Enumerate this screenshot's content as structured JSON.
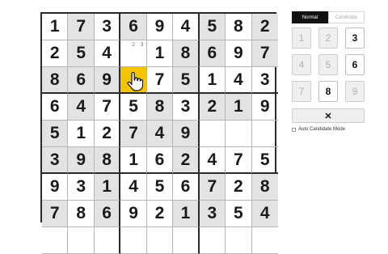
{
  "board": {
    "rows": [
      [
        "1",
        "7",
        "3",
        "6",
        "9",
        "4",
        "5",
        "8",
        "2"
      ],
      [
        "2",
        "5",
        "4",
        "",
        "1",
        "8",
        "6",
        "9",
        "7"
      ],
      [
        "8",
        "6",
        "9",
        "",
        "7",
        "5",
        "1",
        "4",
        "3"
      ],
      [
        "6",
        "4",
        "7",
        "5",
        "8",
        "3",
        "2",
        "1",
        "9"
      ],
      [
        "5",
        "1",
        "2",
        "7",
        "4",
        "9",
        "",
        "",
        ""
      ],
      [
        "3",
        "9",
        "8",
        "1",
        "6",
        "2",
        "4",
        "7",
        "5"
      ],
      [
        "9",
        "3",
        "1",
        "4",
        "5",
        "6",
        "7",
        "2",
        "8"
      ],
      [
        "7",
        "8",
        "6",
        "9",
        "2",
        "1",
        "3",
        "5",
        "4"
      ],
      [
        "",
        "",
        "",
        "",
        "",
        "",
        "",
        "",
        ""
      ]
    ],
    "shaded": [
      [
        0,
        1
      ],
      [
        0,
        3
      ],
      [
        0,
        6
      ],
      [
        0,
        8
      ],
      [
        1,
        1
      ],
      [
        1,
        5
      ],
      [
        1,
        6
      ],
      [
        1,
        8
      ],
      [
        2,
        0
      ],
      [
        2,
        1
      ],
      [
        2,
        2
      ],
      [
        2,
        5
      ],
      [
        3,
        1
      ],
      [
        3,
        4
      ],
      [
        3,
        6
      ],
      [
        3,
        7
      ],
      [
        4,
        0
      ],
      [
        4,
        3
      ],
      [
        4,
        4
      ],
      [
        4,
        5
      ],
      [
        5,
        0
      ],
      [
        5,
        1
      ],
      [
        5,
        2
      ],
      [
        5,
        5
      ],
      [
        6,
        2
      ],
      [
        6,
        6
      ],
      [
        6,
        8
      ],
      [
        7,
        0
      ],
      [
        7,
        2
      ],
      [
        7,
        5
      ],
      [
        7,
        6
      ],
      [
        7,
        8
      ]
    ],
    "selected": [
      2,
      3
    ],
    "candidates": [
      {
        "row": 1,
        "col": 3,
        "notes": [
          "",
          "2",
          "3"
        ]
      }
    ]
  },
  "mode": {
    "normal_label": "Normal",
    "candidate_label": "Candidate",
    "active": "normal"
  },
  "keypad": [
    {
      "label": "1",
      "enabled": false
    },
    {
      "label": "2",
      "enabled": false
    },
    {
      "label": "3",
      "enabled": true
    },
    {
      "label": "4",
      "enabled": false
    },
    {
      "label": "5",
      "enabled": false
    },
    {
      "label": "6",
      "enabled": true
    },
    {
      "label": "7",
      "enabled": false
    },
    {
      "label": "8",
      "enabled": true
    },
    {
      "label": "9",
      "enabled": false
    }
  ],
  "erase_label": "✕",
  "auto_candidate_label": "Auto Candidate Mode",
  "icons": {
    "cursor": "hand-pointer-icon",
    "erase": "close-icon"
  }
}
